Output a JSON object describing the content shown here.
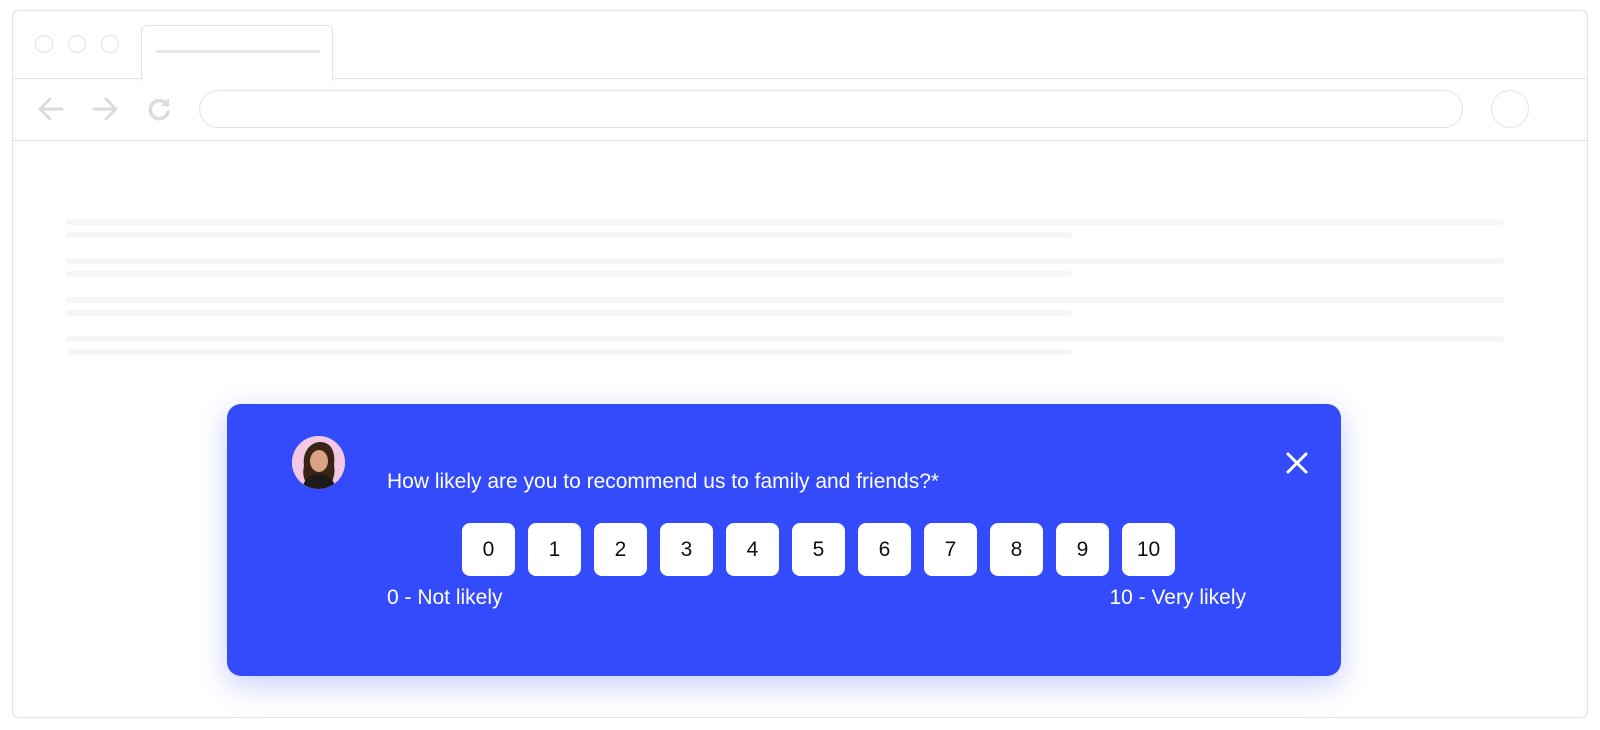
{
  "survey": {
    "question": "How likely are you to recommend us to family and friends?*",
    "scale": [
      "0",
      "1",
      "2",
      "3",
      "4",
      "5",
      "6",
      "7",
      "8",
      "9",
      "10"
    ],
    "low_label": "0 - Not likely",
    "high_label": "10 - Very likely",
    "close_icon": "close-icon",
    "avatar": "avatar",
    "card_color": "#344bfb"
  },
  "browser": {
    "icons": [
      "back-arrow-icon",
      "forward-arrow-icon",
      "reload-icon"
    ]
  }
}
